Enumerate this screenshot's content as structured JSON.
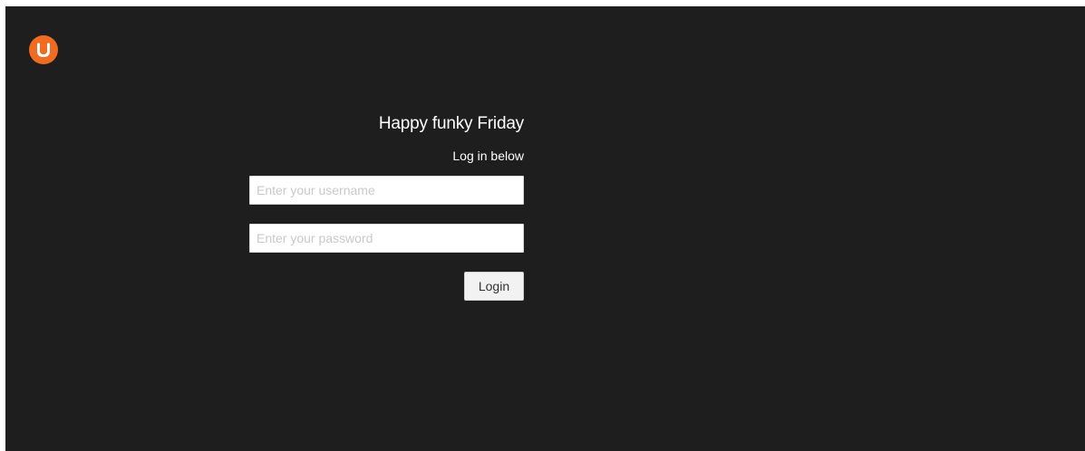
{
  "brand": {
    "logo_icon": "umbraco-logo-icon",
    "logo_color": "#ef6c22"
  },
  "colors": {
    "background": "#1e1e1e",
    "text": "#ffffff"
  },
  "login": {
    "greeting": "Happy funky Friday",
    "subtitle": "Log in below",
    "username_placeholder": "Enter your username",
    "password_placeholder": "Enter your password",
    "button_label": "Login"
  }
}
